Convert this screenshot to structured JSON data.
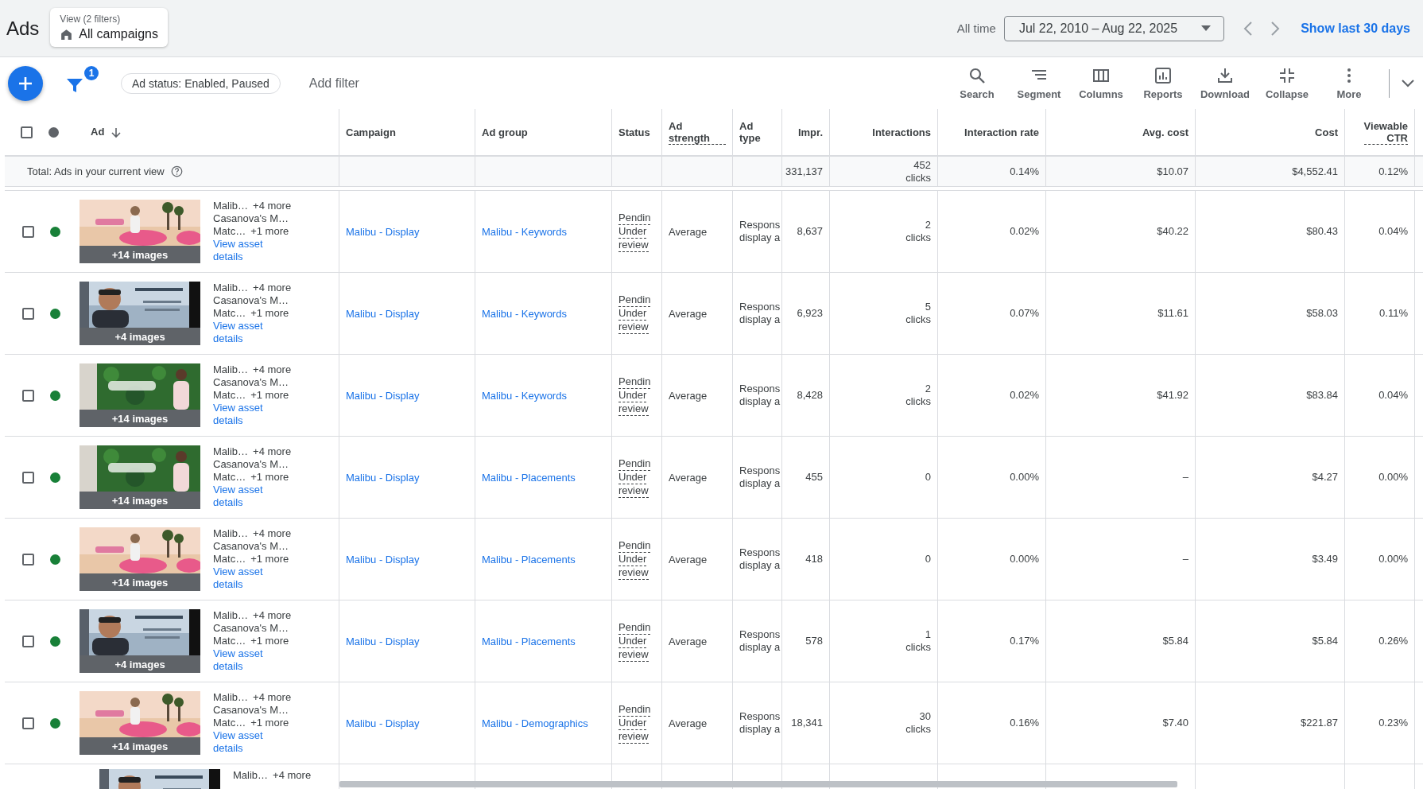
{
  "header": {
    "title": "Ads",
    "view": {
      "label": "View (2 filters)",
      "value": "All campaigns"
    },
    "range_label": "All time",
    "date_range": "Jul 22, 2010 – Aug 22, 2025",
    "quick_link": "Show last 30 days"
  },
  "toolbar": {
    "filter_badge": "1",
    "chips": [
      "Ad status: Enabled, Paused"
    ],
    "add_filter": "Add filter",
    "tools": [
      {
        "kind": "search",
        "label": "Search"
      },
      {
        "kind": "segment",
        "label": "Segment"
      },
      {
        "kind": "columns",
        "label": "Columns"
      },
      {
        "kind": "reports",
        "label": "Reports"
      },
      {
        "kind": "download",
        "label": "Download"
      },
      {
        "kind": "collapse",
        "label": "Collapse"
      },
      {
        "kind": "more",
        "label": "More"
      }
    ]
  },
  "table": {
    "all_selected": false,
    "columns": [
      {
        "label": "Ad",
        "dashed": false,
        "sorted": true
      },
      {
        "label": "Campaign",
        "dashed": false,
        "sorted": false
      },
      {
        "label": "Ad group",
        "dashed": false,
        "sorted": false
      },
      {
        "label": "Status",
        "dashed": false,
        "sorted": false
      },
      {
        "label": "Ad strength",
        "dashed": true,
        "sorted": false
      },
      {
        "label": "Ad type",
        "dashed": false,
        "sorted": false
      },
      {
        "label": "Impr.",
        "dashed": false,
        "sorted": false
      },
      {
        "label": "Interactions",
        "dashed": false,
        "sorted": false
      },
      {
        "label": "Interaction rate",
        "dashed": false,
        "sorted": false
      },
      {
        "label": "Avg. cost",
        "dashed": false,
        "sorted": false
      },
      {
        "label": "Cost",
        "dashed": false,
        "sorted": false
      },
      {
        "label": "Viewable CTR",
        "dashed": true,
        "sorted": false
      }
    ],
    "total": {
      "label": "Total: Ads in your current view",
      "impr": "331,137",
      "interactions": "452 clicks",
      "rate": "0.14%",
      "avg_cost": "$10.07",
      "cost": "$4,552.41",
      "ctr": "0.12%"
    },
    "rows": [
      {
        "checked": false,
        "color": "#188038",
        "images": "+14 images",
        "lines": [
          [
            "Malib…",
            "+4 more"
          ],
          [
            "Casanova's M…"
          ],
          [
            "Matc…",
            "+1 more"
          ]
        ],
        "link": "View asset details",
        "campaign": "Malibu - Display",
        "ad_group": "Malibu - Keywords",
        "status": [
          "Pendin",
          "Under",
          "review"
        ],
        "strength": "Average",
        "type": [
          "Respons",
          "display a"
        ],
        "impr": "8,637",
        "interactions": "2 clicks",
        "rate": "0.02%",
        "avg_cost": "$40.22",
        "cost": "$80.43",
        "ctr": "0.04%"
      },
      {
        "checked": false,
        "color": "#188038",
        "images": "+4 images",
        "lines": [
          [
            "Malib…",
            "+4 more"
          ],
          [
            "Casanova's M…"
          ],
          [
            "Matc…",
            "+1 more"
          ]
        ],
        "link": "View asset details",
        "campaign": "Malibu - Display",
        "ad_group": "Malibu - Keywords",
        "status": [
          "Pendin",
          "Under",
          "review"
        ],
        "strength": "Average",
        "type": [
          "Respons",
          "display a"
        ],
        "impr": "6,923",
        "interactions": "5 clicks",
        "rate": "0.07%",
        "avg_cost": "$11.61",
        "cost": "$58.03",
        "ctr": "0.11%"
      },
      {
        "checked": false,
        "color": "#188038",
        "images": "+14 images",
        "lines": [
          [
            "Malib…",
            "+4 more"
          ],
          [
            "Casanova's M…"
          ],
          [
            "Matc…",
            "+1 more"
          ]
        ],
        "link": "View asset details",
        "campaign": "Malibu - Display",
        "ad_group": "Malibu - Keywords",
        "status": [
          "Pendin",
          "Under",
          "review"
        ],
        "strength": "Average",
        "type": [
          "Respons",
          "display a"
        ],
        "impr": "8,428",
        "interactions": "2 clicks",
        "rate": "0.02%",
        "avg_cost": "$41.92",
        "cost": "$83.84",
        "ctr": "0.04%"
      },
      {
        "checked": false,
        "color": "#188038",
        "images": "+14 images",
        "lines": [
          [
            "Malib…",
            "+4 more"
          ],
          [
            "Casanova's M…"
          ],
          [
            "Matc…",
            "+1 more"
          ]
        ],
        "link": "View asset details",
        "campaign": "Malibu - Display",
        "ad_group": "Malibu - Placements",
        "status": [
          "Pendin",
          "Under",
          "review"
        ],
        "strength": "Average",
        "type": [
          "Respons",
          "display a"
        ],
        "impr": "455",
        "interactions": "0",
        "rate": "0.00%",
        "avg_cost": "–",
        "cost": "$4.27",
        "ctr": "0.00%"
      },
      {
        "checked": false,
        "color": "#188038",
        "images": "+14 images",
        "lines": [
          [
            "Malib…",
            "+4 more"
          ],
          [
            "Casanova's M…"
          ],
          [
            "Matc…",
            "+1 more"
          ]
        ],
        "link": "View asset details",
        "campaign": "Malibu - Display",
        "ad_group": "Malibu - Placements",
        "status": [
          "Pendin",
          "Under",
          "review"
        ],
        "strength": "Average",
        "type": [
          "Respons",
          "display a"
        ],
        "impr": "418",
        "interactions": "0",
        "rate": "0.00%",
        "avg_cost": "–",
        "cost": "$3.49",
        "ctr": "0.00%"
      },
      {
        "checked": false,
        "color": "#188038",
        "images": "+4 images",
        "lines": [
          [
            "Malib…",
            "+4 more"
          ],
          [
            "Casanova's M…"
          ],
          [
            "Matc…",
            "+1 more"
          ]
        ],
        "link": "View asset details",
        "campaign": "Malibu - Display",
        "ad_group": "Malibu - Placements",
        "status": [
          "Pendin",
          "Under",
          "review"
        ],
        "strength": "Average",
        "type": [
          "Respons",
          "display a"
        ],
        "impr": "578",
        "interactions": "1 clicks",
        "rate": "0.17%",
        "avg_cost": "$5.84",
        "cost": "$5.84",
        "ctr": "0.26%"
      },
      {
        "checked": false,
        "color": "#188038",
        "images": "+14 images",
        "lines": [
          [
            "Malib…",
            "+4 more"
          ],
          [
            "Casanova's M…"
          ],
          [
            "Matc…",
            "+1 more"
          ]
        ],
        "link": "View asset details",
        "campaign": "Malibu - Display",
        "ad_group": "Malibu - Demographics",
        "status": [
          "Pendin",
          "Under",
          "review"
        ],
        "strength": "Average",
        "type": [
          "Respons",
          "display a"
        ],
        "impr": "18,341",
        "interactions": "30 clicks",
        "rate": "0.16%",
        "avg_cost": "$7.40",
        "cost": "$221.87",
        "ctr": "0.23%"
      }
    ],
    "partial_row": {
      "lines": [
        [
          "Malib…",
          "+4 more"
        ]
      ]
    }
  }
}
